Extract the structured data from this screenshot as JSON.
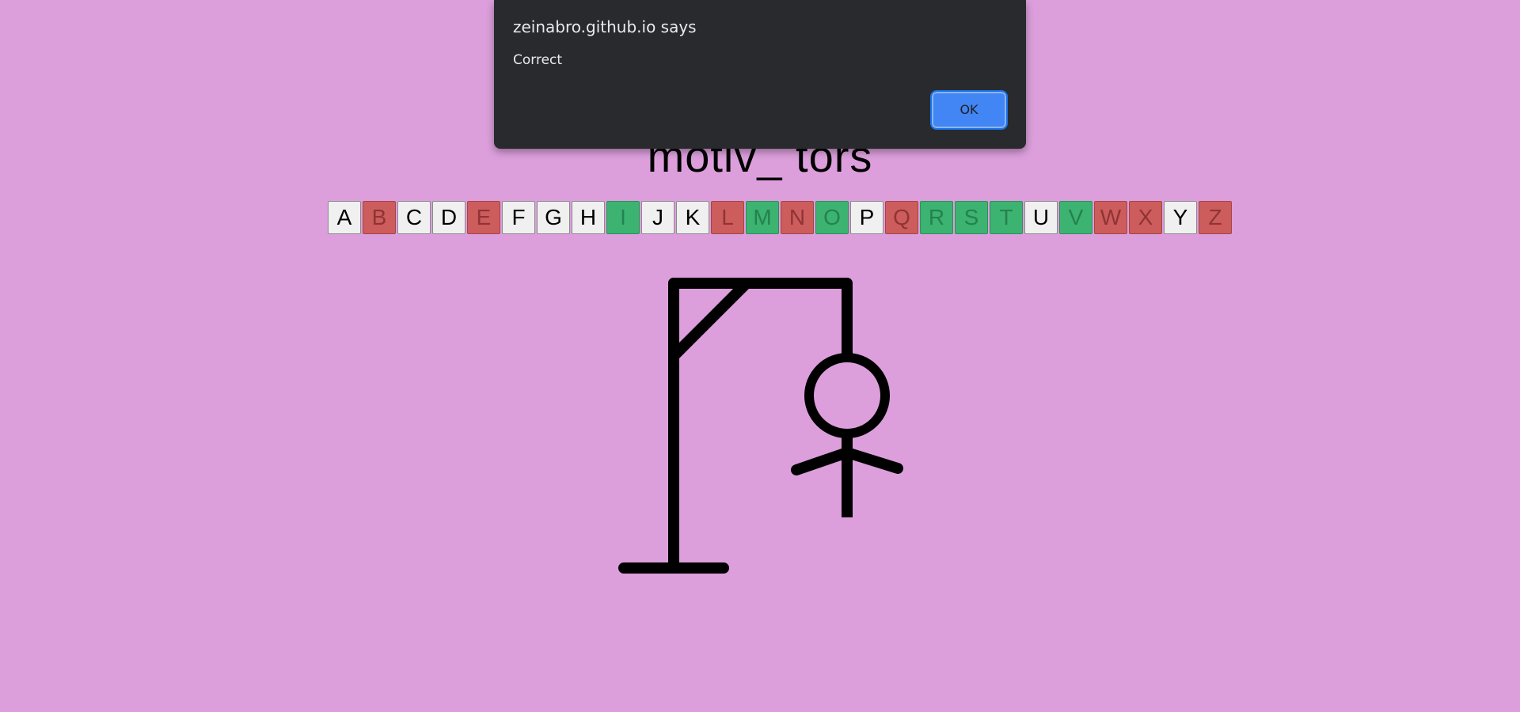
{
  "word": "motiv_ tors",
  "colors": {
    "background": "#dc9fdc",
    "correct": "#3cb371",
    "wrong": "#cd5c5c",
    "unused": "#f0f0f0",
    "dialog_bg": "#292a2d",
    "dialog_button": "#4285f4"
  },
  "letters": [
    {
      "label": "A",
      "state": "unused"
    },
    {
      "label": "B",
      "state": "wrong"
    },
    {
      "label": "C",
      "state": "unused"
    },
    {
      "label": "D",
      "state": "unused"
    },
    {
      "label": "E",
      "state": "wrong"
    },
    {
      "label": "F",
      "state": "unused"
    },
    {
      "label": "G",
      "state": "unused"
    },
    {
      "label": "H",
      "state": "unused"
    },
    {
      "label": "I",
      "state": "correct"
    },
    {
      "label": "J",
      "state": "unused"
    },
    {
      "label": "K",
      "state": "unused"
    },
    {
      "label": "L",
      "state": "wrong"
    },
    {
      "label": "M",
      "state": "correct"
    },
    {
      "label": "N",
      "state": "wrong"
    },
    {
      "label": "O",
      "state": "correct"
    },
    {
      "label": "P",
      "state": "unused"
    },
    {
      "label": "Q",
      "state": "wrong"
    },
    {
      "label": "R",
      "state": "correct"
    },
    {
      "label": "S",
      "state": "correct"
    },
    {
      "label": "T",
      "state": "correct"
    },
    {
      "label": "U",
      "state": "unused"
    },
    {
      "label": "V",
      "state": "correct"
    },
    {
      "label": "W",
      "state": "wrong"
    },
    {
      "label": "X",
      "state": "wrong"
    },
    {
      "label": "Y",
      "state": "unused"
    },
    {
      "label": "Z",
      "state": "wrong"
    }
  ],
  "hangman": {
    "parts_shown": [
      "base",
      "pole",
      "beam",
      "brace",
      "rope",
      "head",
      "body",
      "arms"
    ]
  },
  "dialog": {
    "title": "zeinabro.github.io says",
    "message": "Correct",
    "ok_label": "OK"
  }
}
